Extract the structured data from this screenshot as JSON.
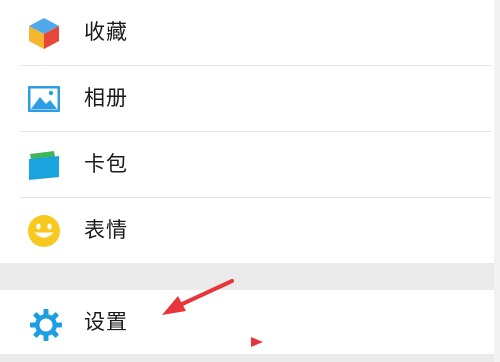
{
  "menu": {
    "items": [
      {
        "label": "收藏",
        "icon": "favorites-cube-icon"
      },
      {
        "label": "相册",
        "icon": "album-picture-icon"
      },
      {
        "label": "卡包",
        "icon": "card-wallet-icon"
      },
      {
        "label": "表情",
        "icon": "smiley-face-icon"
      }
    ],
    "settings": {
      "label": "设置",
      "icon": "settings-gear-icon"
    }
  },
  "colors": {
    "accent_blue": "#1e9de0",
    "annotation_red": "#e8353b",
    "section_gap": "#ebebeb"
  }
}
